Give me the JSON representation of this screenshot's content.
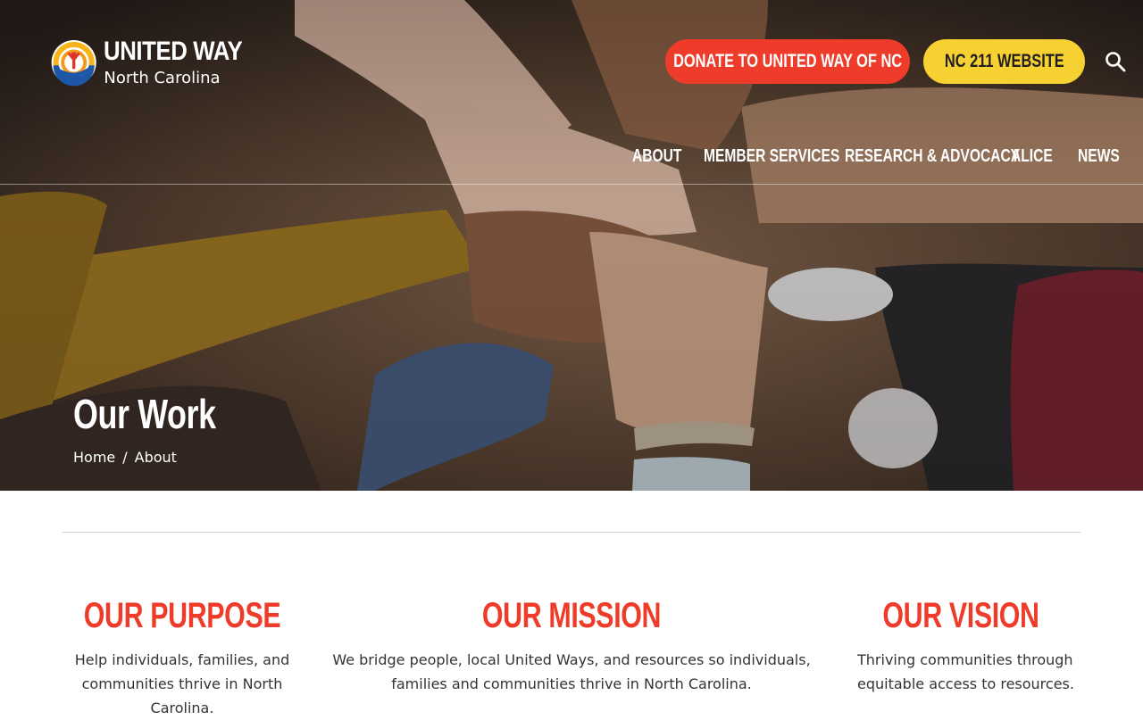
{
  "logo": {
    "title": "UNITED WAY",
    "subtitle": "North Carolina"
  },
  "header": {
    "donate_label": "DONATE TO UNITED WAY OF NC",
    "nc211_label": "NC 211 WEBSITE",
    "search_icon": "search-icon"
  },
  "nav": {
    "items": [
      {
        "label": "ABOUT"
      },
      {
        "label": "MEMBER SERVICES"
      },
      {
        "label": "RESEARCH & ADVOCACY"
      },
      {
        "label": "ALICE"
      },
      {
        "label": "NEWS"
      }
    ]
  },
  "hero": {
    "title": "Our Work",
    "breadcrumb": {
      "home": "Home",
      "separator": "/",
      "current": "About"
    }
  },
  "columns": [
    {
      "heading": "OUR PURPOSE",
      "text": "Help individuals, families, and communities thrive in North Carolina."
    },
    {
      "heading": "OUR MISSION",
      "text": "We bridge people, local United Ways, and resources so individuals, families and communities thrive in North Carolina."
    },
    {
      "heading": "OUR VISION",
      "text": "Thriving communities through equitable access to resources."
    }
  ],
  "colors": {
    "accent_red": "#ee3b2a",
    "accent_yellow": "#f7d131",
    "text_dark": "#333333"
  }
}
